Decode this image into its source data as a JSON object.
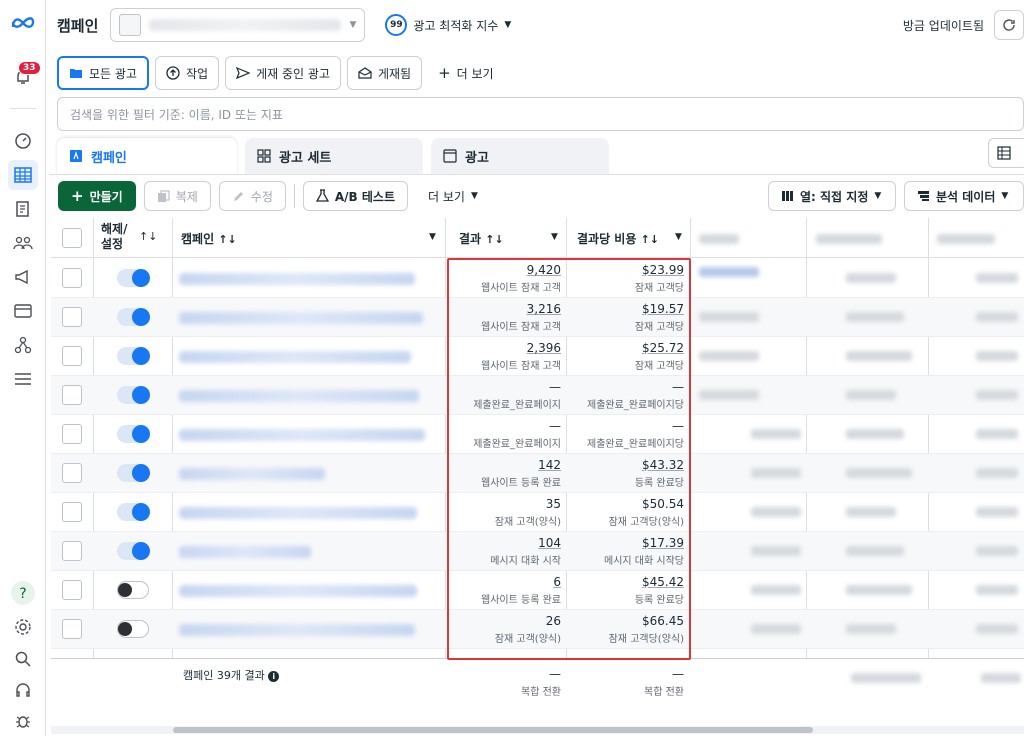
{
  "header": {
    "title": "캠페인",
    "score_value": "99",
    "score_label": "광고 최적화 지수",
    "updated": "방금 업데이트됨"
  },
  "rail": {
    "notification_count": "33"
  },
  "filters": {
    "all_ads": "모든 광고",
    "drafts": "작업",
    "active_ads": "게재 중인 광고",
    "delivered": "게재됨",
    "more": "더 보기"
  },
  "search": {
    "placeholder": "검색을 위한 필터 기준: 이름, ID 또는 지표"
  },
  "tabs": {
    "campaign": "캠페인",
    "adset": "광고 세트",
    "ad": "광고"
  },
  "toolbar": {
    "create": "만들기",
    "duplicate": "복제",
    "edit": "수정",
    "ab_test": "A/B 테스트",
    "more": "더 보기",
    "columns": "열: 직접 지정",
    "breakdown": "분석 데이터"
  },
  "table": {
    "headers": {
      "toggle": "해제/\n설정",
      "campaign": "캠페인",
      "results": "결과",
      "cost_per_result": "결과당 비용"
    },
    "rows": [
      {
        "on": true,
        "name_w": 236,
        "result": "9,420",
        "result_sub": "웹사이트 잠재 고객",
        "cost": "$23.99",
        "cost_sub": "잠재 고객당"
      },
      {
        "on": true,
        "name_w": 244,
        "result": "3,216",
        "result_sub": "웹사이트 잠재 고객",
        "cost": "$19.57",
        "cost_sub": "잠재 고객당"
      },
      {
        "on": true,
        "name_w": 232,
        "result": "2,396",
        "result_sub": "웹사이트 잠재 고객",
        "cost": "$25.72",
        "cost_sub": "잠재 고객당"
      },
      {
        "on": true,
        "name_w": 240,
        "result": "—",
        "result_sub": "제출완료_완료페이지",
        "cost": "—",
        "cost_sub": "제출완료_완료페이지당"
      },
      {
        "on": true,
        "name_w": 246,
        "result": "—",
        "result_sub": "제출완료_완료페이지",
        "cost": "—",
        "cost_sub": "제출완료_완료페이지당"
      },
      {
        "on": true,
        "name_w": 146,
        "result": "142",
        "result_sub": "웹사이트 등록 완료",
        "cost": "$43.32",
        "cost_sub": "등록 완료당"
      },
      {
        "on": true,
        "name_w": 238,
        "result": "35",
        "result_sub": "잠재 고객(양식)",
        "cost": "$50.54",
        "cost_sub": "잠재 고객당(양식)"
      },
      {
        "on": true,
        "name_w": 132,
        "result": "104",
        "result_sub": "메시지 대화 시작",
        "cost": "$17.39",
        "cost_sub": "메시지 대화 시작당"
      },
      {
        "on": false,
        "name_w": 238,
        "result": "6",
        "result_sub": "웹사이트 등록 완료",
        "cost": "$45.42",
        "cost_sub": "등록 완료당"
      },
      {
        "on": false,
        "name_w": 236,
        "result": "26",
        "result_sub": "잠재 고객(양식)",
        "cost": "$66.45",
        "cost_sub": "잠재 고객당(양식)"
      }
    ],
    "footer": {
      "count_label": "캠페인 39개 결과",
      "result": "—",
      "result_sub": "복합 전환",
      "cost": "—",
      "cost_sub": "복합 전환"
    }
  },
  "colors": {
    "accent": "#1877f2",
    "create_button": "#0a6638",
    "highlight_box": "#d9363e"
  }
}
